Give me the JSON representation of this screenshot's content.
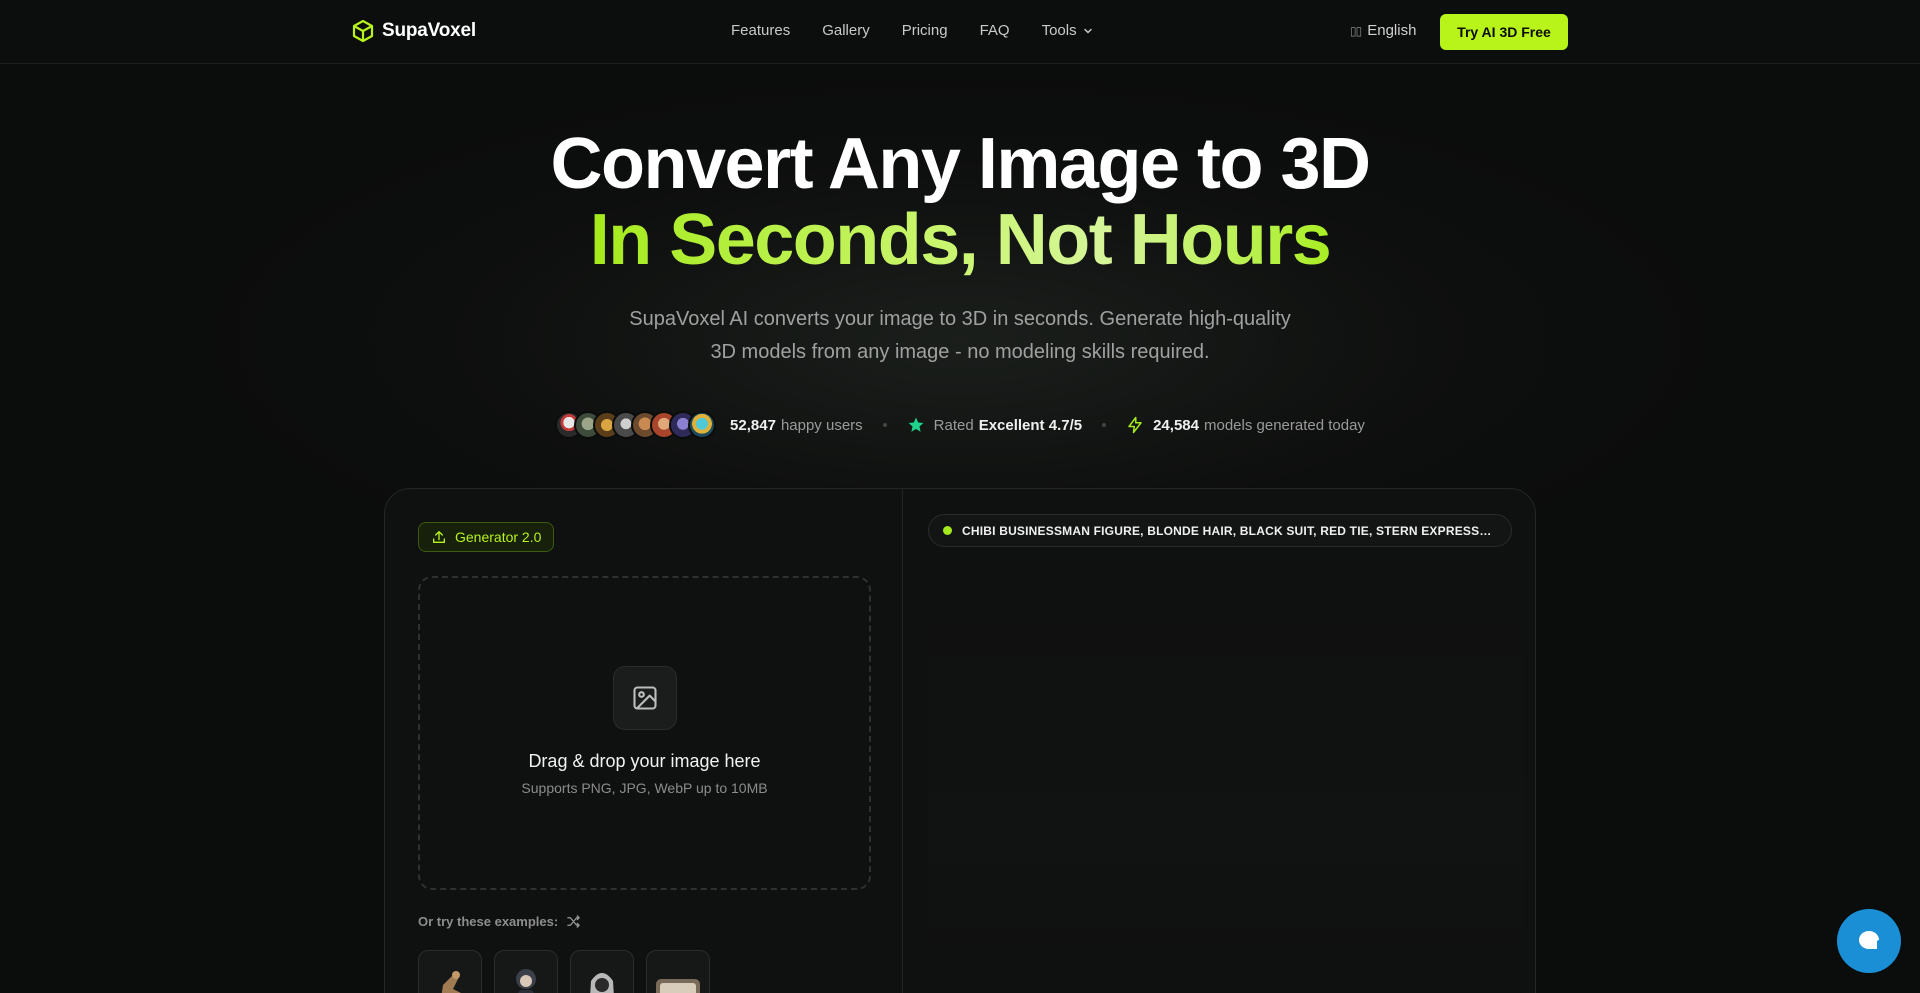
{
  "nav": {
    "brand": "SupaVoxel",
    "links": [
      "Features",
      "Gallery",
      "Pricing",
      "FAQ",
      "Tools"
    ],
    "language": "English",
    "cta": "Try AI 3D Free"
  },
  "hero": {
    "title_line1": "Convert Any Image to 3D",
    "title_line2": "In Seconds, Not Hours",
    "subtitle": "SupaVoxel AI converts your image to 3D in seconds. Generate high-quality 3D models from any image - no modeling skills required."
  },
  "stats": {
    "users_count": "52,847",
    "users_label": "happy users",
    "rating_prefix": "Rated",
    "rating_value": "Excellent 4.7/5",
    "models_count": "24,584",
    "models_label": "models generated today"
  },
  "generator": {
    "badge": "Generator 2.0",
    "drop_title": "Drag & drop your image here",
    "drop_sub": "Supports PNG, JPG, WebP up to 10MB",
    "examples_label": "Or try these examples:"
  },
  "preview": {
    "prompt": "CHIBI BUSINESSMAN FIGURE, BLONDE HAIR, BLACK SUIT, RED TIE, STERN EXPRESSION"
  },
  "colors": {
    "accent": "#b8f31a",
    "background": "#0b0c0c",
    "chat_button": "#1a8fd6"
  }
}
